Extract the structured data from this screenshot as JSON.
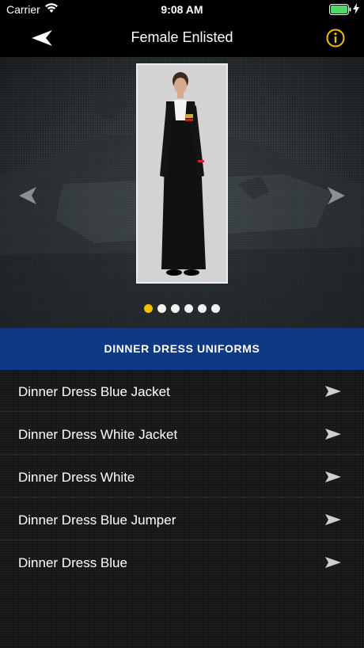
{
  "status_bar": {
    "carrier": "Carrier",
    "time": "9:08 AM"
  },
  "navbar": {
    "title": "Female Enlisted",
    "back_icon": "back-arrow-icon",
    "info_icon": "info-icon"
  },
  "carousel": {
    "page_count": 6,
    "active_index": 0
  },
  "section": {
    "title": "DINNER DRESS UNIFORMS"
  },
  "list": {
    "items": [
      {
        "label": "Dinner Dress Blue Jacket"
      },
      {
        "label": "Dinner Dress White Jacket"
      },
      {
        "label": "Dinner Dress White"
      },
      {
        "label": "Dinner Dress Blue Jumper"
      },
      {
        "label": "Dinner Dress Blue"
      }
    ]
  },
  "colors": {
    "accent": "#F2C200",
    "section_header": "#0E3A84",
    "background": "#000000"
  }
}
